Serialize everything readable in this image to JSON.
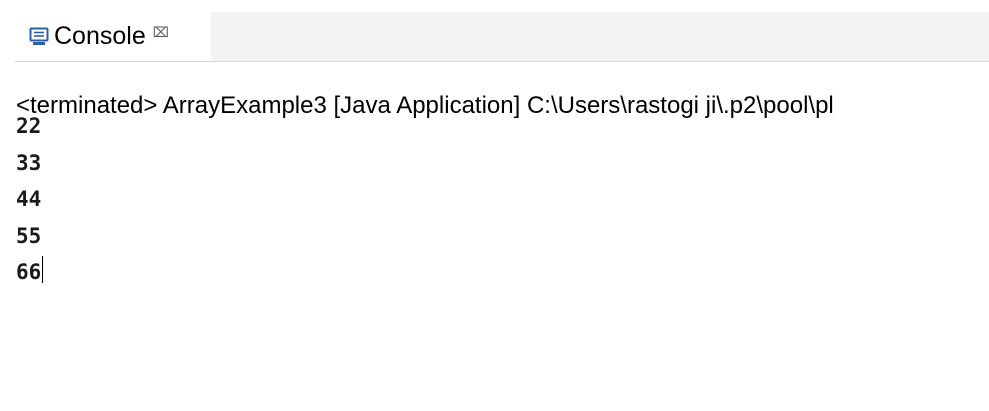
{
  "tab": {
    "title": "Console",
    "close_glyph": "⌧",
    "icon": "console-monitor-icon",
    "close_icon": "close-icon"
  },
  "status": {
    "text": "<terminated> ArrayExample3 [Java Application] C:\\Users\\rastogi ji\\.p2\\pool\\pl"
  },
  "output": {
    "lines": [
      "22",
      "33",
      "44",
      "55",
      "66"
    ]
  },
  "colors": {
    "tab_strip_bg": "#f3f3f3",
    "console_bg": "#ffffff",
    "icon_blue": "#2c5fa8",
    "text": "#000000"
  }
}
